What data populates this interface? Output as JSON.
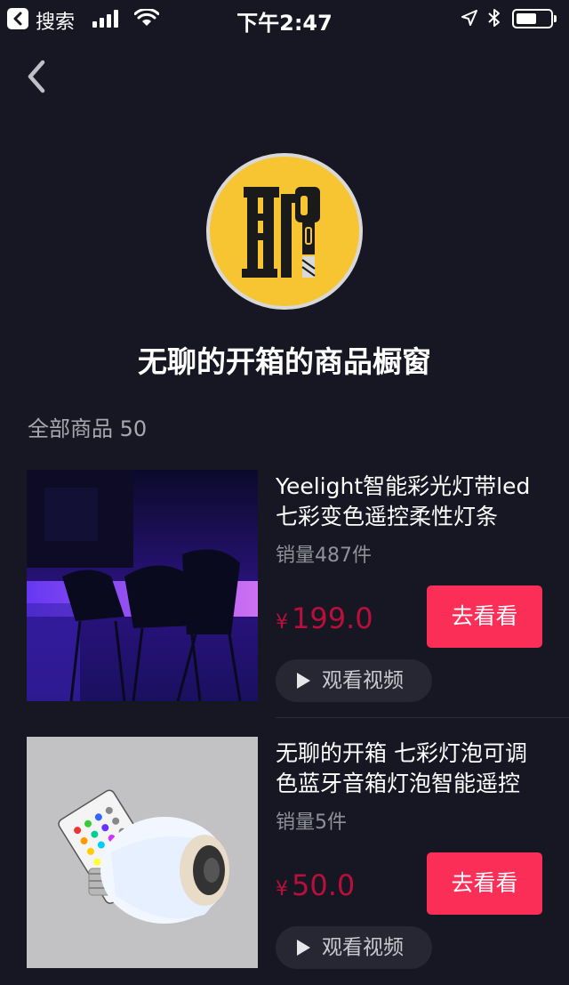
{
  "status_bar": {
    "back_app": "搜索",
    "time": "下午2:47"
  },
  "shop": {
    "title": "无聊的开箱的商品橱窗",
    "count_label": "全部商品 50"
  },
  "products": [
    {
      "title": "Yeelight智能彩光灯带led七彩变色遥控柔性灯条",
      "sales": "销量487件",
      "currency": "¥",
      "price": "199.0",
      "go_label": "去看看",
      "video_label": "观看视频"
    },
    {
      "title": "无聊的开箱 七彩灯泡可调色蓝牙音箱灯泡智能遥控",
      "sales": "销量5件",
      "currency": "¥",
      "price": "50.0",
      "go_label": "去看看",
      "video_label": "观看视频"
    }
  ],
  "colors": {
    "background": "#161723",
    "accent": "#fb2e58",
    "price": "#b8103a",
    "avatar_bg": "#f6c531"
  }
}
